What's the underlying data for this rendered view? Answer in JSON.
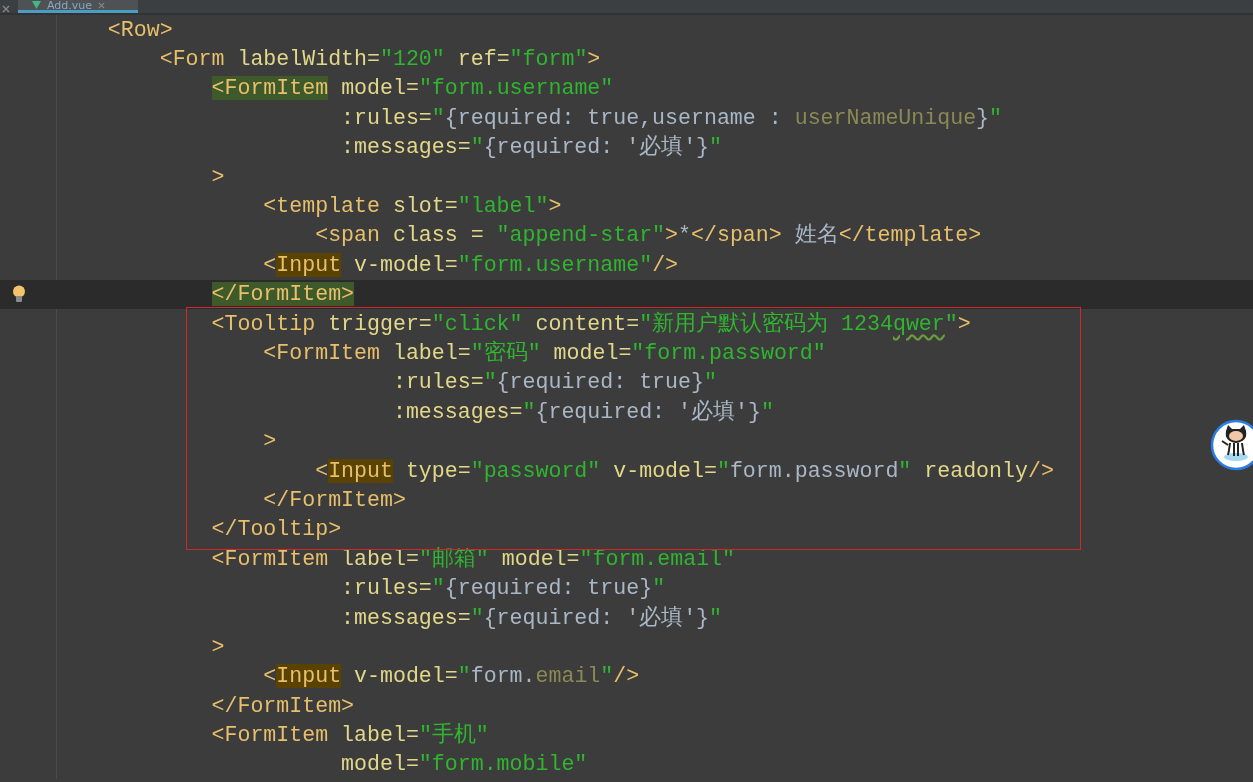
{
  "tabs": [
    {
      "label": "Add.vue",
      "selected": true
    }
  ],
  "lines": [
    {
      "tokens": [
        {
          "kind": "tag",
          "text": "    <Row>"
        }
      ]
    },
    {
      "tokens": [
        {
          "kind": "tag",
          "text": "        <Form "
        },
        {
          "kind": "attr",
          "text": "labelWidth="
        },
        {
          "kind": "string",
          "text": "\"120\" "
        },
        {
          "kind": "attr",
          "text": "ref="
        },
        {
          "kind": "string",
          "text": "\"form\""
        },
        {
          "kind": "tag",
          "text": ">"
        }
      ]
    },
    {
      "tokens": [
        {
          "kind": "tag",
          "text": "            <FormItem",
          "pair_highlight": true
        },
        {
          "kind": "attr",
          "text": " model="
        },
        {
          "kind": "string",
          "text": "\"form.username\""
        }
      ]
    },
    {
      "tokens": [
        {
          "kind": "attr",
          "text": "                      :rules="
        },
        {
          "kind": "string",
          "text": "\""
        },
        {
          "kind": "text",
          "text": "{required: true,username : "
        },
        {
          "kind": "dim",
          "text": "userNameUnique"
        },
        {
          "kind": "text",
          "text": "}"
        },
        {
          "kind": "string",
          "text": "\""
        }
      ]
    },
    {
      "tokens": [
        {
          "kind": "attr",
          "text": "                      :messages="
        },
        {
          "kind": "string",
          "text": "\""
        },
        {
          "kind": "text",
          "text": "{required: '必填'}"
        },
        {
          "kind": "string",
          "text": "\""
        }
      ]
    },
    {
      "tokens": [
        {
          "kind": "tag",
          "text": "            >"
        }
      ]
    },
    {
      "tokens": [
        {
          "kind": "tag",
          "text": "                <template "
        },
        {
          "kind": "attr",
          "text": "slot="
        },
        {
          "kind": "string",
          "text": "\"label\""
        },
        {
          "kind": "tag",
          "text": ">"
        }
      ]
    },
    {
      "tokens": [
        {
          "kind": "tag",
          "text": "                    <span "
        },
        {
          "kind": "attr",
          "text": "class = "
        },
        {
          "kind": "string",
          "text": "\"append-star\""
        },
        {
          "kind": "tag",
          "text": ">"
        },
        {
          "kind": "text",
          "text": "*"
        },
        {
          "kind": "tag",
          "text": "</span>"
        },
        {
          "kind": "text",
          "text": " 姓名"
        },
        {
          "kind": "tag",
          "text": "</template>"
        }
      ]
    },
    {
      "tokens": [
        {
          "kind": "tag",
          "text": "                <"
        },
        {
          "kind": "tag",
          "text": "Input",
          "usage_highlight": true
        },
        {
          "kind": "attr",
          "text": " v-model="
        },
        {
          "kind": "string",
          "text": "\"form.username\""
        },
        {
          "kind": "tag",
          "text": "/>"
        }
      ]
    },
    {
      "current": true,
      "tokens": [
        {
          "kind": "tag",
          "text": "            </FormItem>",
          "pair_highlight": true
        }
      ]
    },
    {
      "boxed": true,
      "tokens": [
        {
          "kind": "tag",
          "text": "            <Tooltip "
        },
        {
          "kind": "attr",
          "text": "trigger="
        },
        {
          "kind": "string",
          "text": "\"click\" "
        },
        {
          "kind": "attr",
          "text": "content="
        },
        {
          "kind": "string",
          "text": "\"新用户默认密码为 1234"
        },
        {
          "kind": "string",
          "text": "qwer",
          "typo": true
        },
        {
          "kind": "string",
          "text": "\""
        },
        {
          "kind": "tag",
          "text": ">"
        }
      ]
    },
    {
      "boxed": true,
      "tokens": [
        {
          "kind": "tag",
          "text": "                <FormItem "
        },
        {
          "kind": "attr",
          "text": "label="
        },
        {
          "kind": "string",
          "text": "\"密码\" "
        },
        {
          "kind": "attr",
          "text": "model="
        },
        {
          "kind": "string",
          "text": "\"form.password\""
        }
      ]
    },
    {
      "boxed": true,
      "tokens": [
        {
          "kind": "attr",
          "text": "                          :rules="
        },
        {
          "kind": "string",
          "text": "\""
        },
        {
          "kind": "text",
          "text": "{required: true}"
        },
        {
          "kind": "string",
          "text": "\""
        }
      ]
    },
    {
      "boxed": true,
      "tokens": [
        {
          "kind": "attr",
          "text": "                          :messages="
        },
        {
          "kind": "string",
          "text": "\""
        },
        {
          "kind": "text",
          "text": "{required: '必填'}"
        },
        {
          "kind": "string",
          "text": "\""
        }
      ]
    },
    {
      "boxed": true,
      "tokens": [
        {
          "kind": "tag",
          "text": "                >"
        }
      ]
    },
    {
      "boxed": true,
      "tokens": [
        {
          "kind": "tag",
          "text": "                    <"
        },
        {
          "kind": "tag",
          "text": "Input",
          "usage_highlight": true
        },
        {
          "kind": "attr",
          "text": " type="
        },
        {
          "kind": "string",
          "text": "\"password\" "
        },
        {
          "kind": "attr",
          "text": "v-model="
        },
        {
          "kind": "string",
          "text": "\""
        },
        {
          "kind": "text",
          "text": "form.password"
        },
        {
          "kind": "string",
          "text": "\" "
        },
        {
          "kind": "attr",
          "text": "readonly"
        },
        {
          "kind": "tag",
          "text": "/>"
        }
      ]
    },
    {
      "boxed": true,
      "tokens": [
        {
          "kind": "tag",
          "text": "                </FormItem>"
        }
      ]
    },
    {
      "boxed": true,
      "tokens": [
        {
          "kind": "tag",
          "text": "            </Tooltip>"
        }
      ]
    },
    {
      "tokens": [
        {
          "kind": "tag",
          "text": "            <FormItem "
        },
        {
          "kind": "attr",
          "text": "label="
        },
        {
          "kind": "string",
          "text": "\"邮箱\" "
        },
        {
          "kind": "attr",
          "text": "model="
        },
        {
          "kind": "string",
          "text": "\"form.email\""
        }
      ]
    },
    {
      "tokens": [
        {
          "kind": "attr",
          "text": "                      :rules="
        },
        {
          "kind": "string",
          "text": "\""
        },
        {
          "kind": "text",
          "text": "{required: true}"
        },
        {
          "kind": "string",
          "text": "\""
        }
      ]
    },
    {
      "tokens": [
        {
          "kind": "attr",
          "text": "                      :messages="
        },
        {
          "kind": "string",
          "text": "\""
        },
        {
          "kind": "text",
          "text": "{required: '必填'}"
        },
        {
          "kind": "string",
          "text": "\""
        }
      ]
    },
    {
      "tokens": [
        {
          "kind": "tag",
          "text": "            >"
        }
      ]
    },
    {
      "tokens": [
        {
          "kind": "tag",
          "text": "                <"
        },
        {
          "kind": "tag",
          "text": "Input",
          "usage_highlight": true
        },
        {
          "kind": "attr",
          "text": " v-model="
        },
        {
          "kind": "string",
          "text": "\""
        },
        {
          "kind": "text",
          "text": "form."
        },
        {
          "kind": "dim",
          "text": "email"
        },
        {
          "kind": "string",
          "text": "\""
        },
        {
          "kind": "tag",
          "text": "/>"
        }
      ]
    },
    {
      "tokens": [
        {
          "kind": "tag",
          "text": "            </FormItem>"
        }
      ]
    },
    {
      "tokens": [
        {
          "kind": "tag",
          "text": "            <FormItem "
        },
        {
          "kind": "attr",
          "text": "label="
        },
        {
          "kind": "string",
          "text": "\"手机\""
        }
      ]
    },
    {
      "tokens": [
        {
          "kind": "attr",
          "text": "                      model="
        },
        {
          "kind": "string",
          "text": "\"form.mobile\""
        }
      ]
    }
  ]
}
